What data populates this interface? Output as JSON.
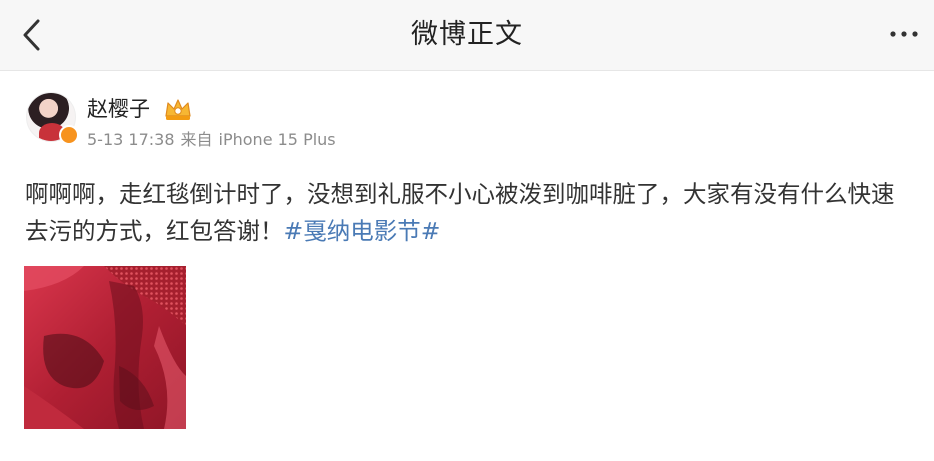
{
  "topbar": {
    "title": "微博正文",
    "back_icon": "chevron-left-icon",
    "more_icon": "ellipsis-icon"
  },
  "post": {
    "author": {
      "name": "赵樱子",
      "verified_color": "#f7931e",
      "badge_icon": "crown-badge-icon"
    },
    "meta": {
      "date": "5-13 17:38",
      "source_prefix": "来自",
      "device": "iPhone 15 Plus"
    },
    "text": "啊啊啊，走红毯倒计时了，没想到礼服不小心被泼到咖啡脏了，大家有没有什么快速去污的方式，红包答谢！",
    "hashtag": "#戛纳电影节#"
  },
  "colors": {
    "hashtag": "#4a7ab5",
    "meta": "#8c8c8c",
    "topbar_bg": "#f7f7f7"
  }
}
